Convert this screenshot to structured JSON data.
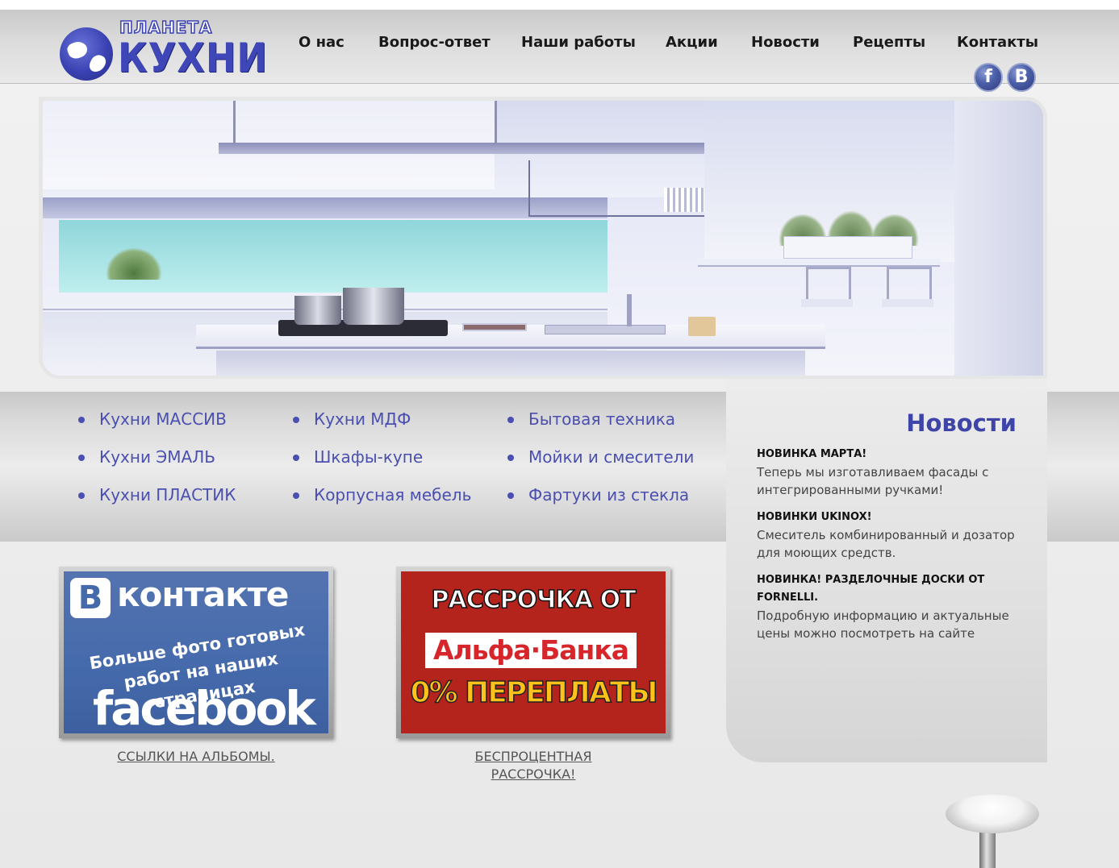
{
  "logo": {
    "small": "ПЛАНЕТА",
    "big": "КУХНИ"
  },
  "nav": [
    {
      "label": "О нас"
    },
    {
      "label": "Вопрос-ответ"
    },
    {
      "label": "Наши работы"
    },
    {
      "label": "Акции"
    },
    {
      "label": "Новости"
    },
    {
      "label": "Рецепты"
    },
    {
      "label": "Контакты"
    }
  ],
  "social": {
    "facebook": "f",
    "vk": "B"
  },
  "categories": [
    [
      "Кухни МАССИВ",
      "Кухни ЭМАЛЬ",
      "Кухни ПЛАСТИК"
    ],
    [
      "Кухни МДФ",
      "Шкафы-купе",
      "Корпусная мебель"
    ],
    [
      "Бытовая техника",
      "Мойки и смесители",
      "Фартуки из стекла"
    ]
  ],
  "news": {
    "title": "Новости",
    "items": [
      {
        "title": "НОВИНКА МАРТА!",
        "text": "Теперь мы изготавливаем фасады с интегрированными ручками!"
      },
      {
        "title": "НОВИНКИ UKINOX!",
        "text": "Смеситель комбинированный и дозатор для моющих средств."
      },
      {
        "title": "НОВИНКА! РАЗДЕЛОЧНЫЕ ДОСКИ ОТ FORNELLI.",
        "text": "Подробную информацию и актуальные цены можно посмотреть на сайте"
      }
    ]
  },
  "banners": {
    "vk": {
      "logo_letter": "B",
      "brand": "контакте",
      "slogan_line1": "Больше фото готовых",
      "slogan_line2": "работ на наших страницах",
      "facebook": "facebook",
      "link": "ССЫЛКИ НА АЛЬБОМЫ."
    },
    "rassrochka": {
      "top": "РАССРОЧКА ОТ",
      "bank": "Альфа·Банка",
      "bottom": "0% ПЕРЕПЛАТЫ",
      "link_line1": "БЕСПРОЦЕНТНАЯ",
      "link_line2": "РАССРОЧКА!"
    }
  },
  "colors": {
    "accent": "#4a4fb0",
    "news_title": "#3f44a8",
    "vk_blue": "#456aab",
    "alfa_red": "#d7262b",
    "rassrochka_bg": "#b5231d"
  }
}
